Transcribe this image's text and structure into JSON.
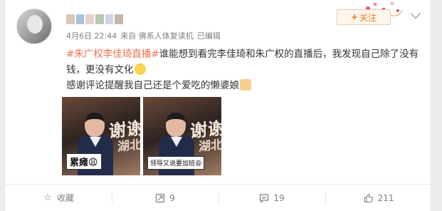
{
  "post": {
    "follow_label": "关注",
    "meta": {
      "date": "4月6日 22:44",
      "source": "来自 佛系人体复读机",
      "edited": "已编辑"
    },
    "hashtag": "#朱广权李佳琦直播#",
    "line1": "谁能想到看完李佳琦和朱广权的直播后，我发现自己除了没有钱，更没有文化",
    "line2": "感谢评论提醒我自己还是个爱吃的懒婆娘",
    "images": [
      {
        "banner": "谢谢",
        "banner2": "湖北",
        "caption": "累瘫😩"
      },
      {
        "banner": "谢谢",
        "banner2": "湖北",
        "caption": "领导又说要加班😩"
      }
    ],
    "username_blocks": [
      "#d9c7b8",
      "#a7c4de",
      "#e8d1d1",
      "#b9c9b0",
      "#d2d2e8",
      "#c8b7a8"
    ]
  },
  "actions": {
    "favorite_label": "收藏",
    "repost_count": "9",
    "comment_count": "19",
    "like_count": "211"
  },
  "colors": {
    "accent": "#eb7350",
    "follow_border": "#f1c8a4"
  }
}
